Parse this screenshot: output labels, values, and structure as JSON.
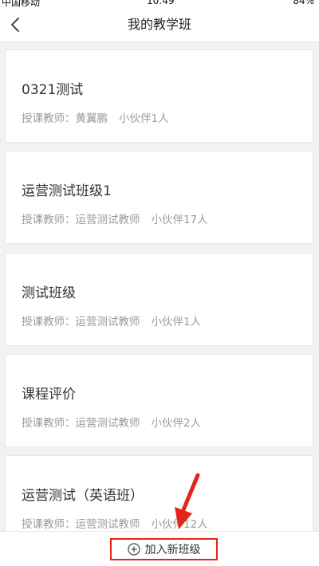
{
  "status_bar": {
    "carrier": "中国移动",
    "time": "10:49",
    "battery": "84%"
  },
  "header": {
    "title": "我的教学班"
  },
  "classes": [
    {
      "name": "0321测试",
      "teacher_label": "授课教师：",
      "teacher": "黄翼鹏",
      "members": "小伙伴1人"
    },
    {
      "name": "运营测试班级1",
      "teacher_label": "授课教师：",
      "teacher": "运营测试教师",
      "members": "小伙伴17人"
    },
    {
      "name": "测试班级",
      "teacher_label": "授课教师：",
      "teacher": "运营测试教师",
      "members": "小伙伴1人"
    },
    {
      "name": "课程评价",
      "teacher_label": "授课教师：",
      "teacher": "运营测试教师",
      "members": "小伙伴2人"
    },
    {
      "name": "运营测试（英语班）",
      "teacher_label": "授课教师：",
      "teacher": "运营测试教师",
      "members": "小伙伴12人"
    }
  ],
  "footer": {
    "add_class_label": "加入新班级"
  },
  "colors": {
    "highlight_red": "#e2261b",
    "background": "#f2f2f2",
    "card": "#ffffff",
    "secondary_text": "#9a9a9a"
  },
  "icons": {
    "back": "chevron-left-icon",
    "add": "plus-circle-icon",
    "annotation": "red-arrow-icon"
  }
}
